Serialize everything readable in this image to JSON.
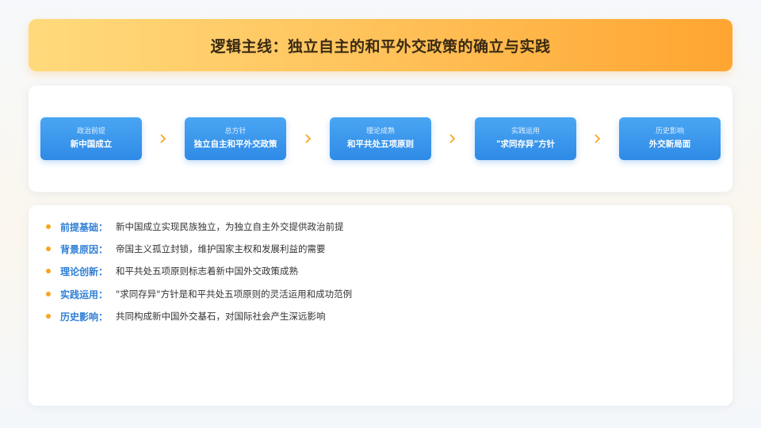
{
  "title": "逻辑主线：独立自主的和平外交政策的确立与实践",
  "flow": [
    {
      "label": "政治前提",
      "value": "新中国成立"
    },
    {
      "label": "总方针",
      "value": "独立自主和平外交政策"
    },
    {
      "label": "理论成熟",
      "value": "和平共处五项原则"
    },
    {
      "label": "实践运用",
      "value": "\"求同存异\"方针"
    },
    {
      "label": "历史影响",
      "value": "外交新局面"
    }
  ],
  "items": [
    {
      "label": "前提基础：",
      "text": "新中国成立实现民族独立，为独立自主外交提供政治前提"
    },
    {
      "label": "背景原因：",
      "text": "帝国主义孤立封锁，维护国家主权和发展利益的需要"
    },
    {
      "label": "理论创新：",
      "text": "和平共处五项原则标志着新中国外交政策成熟"
    },
    {
      "label": "实践运用：",
      "text": "\"求同存异\"方针是和平共处五项原则的灵活运用和成功范例"
    },
    {
      "label": "历史影响：",
      "text": "共同构成新中国外交基石，对国际社会产生深远影响"
    }
  ],
  "colors": {
    "accent_orange": "#ffa531",
    "step_blue": "#2f8ae6",
    "label_blue": "#2f7fd6",
    "bullet": "#f5a623"
  },
  "icons": {
    "flow_arrow": "chevron-right-icon",
    "list_bullet": "bullet-dot-icon"
  }
}
